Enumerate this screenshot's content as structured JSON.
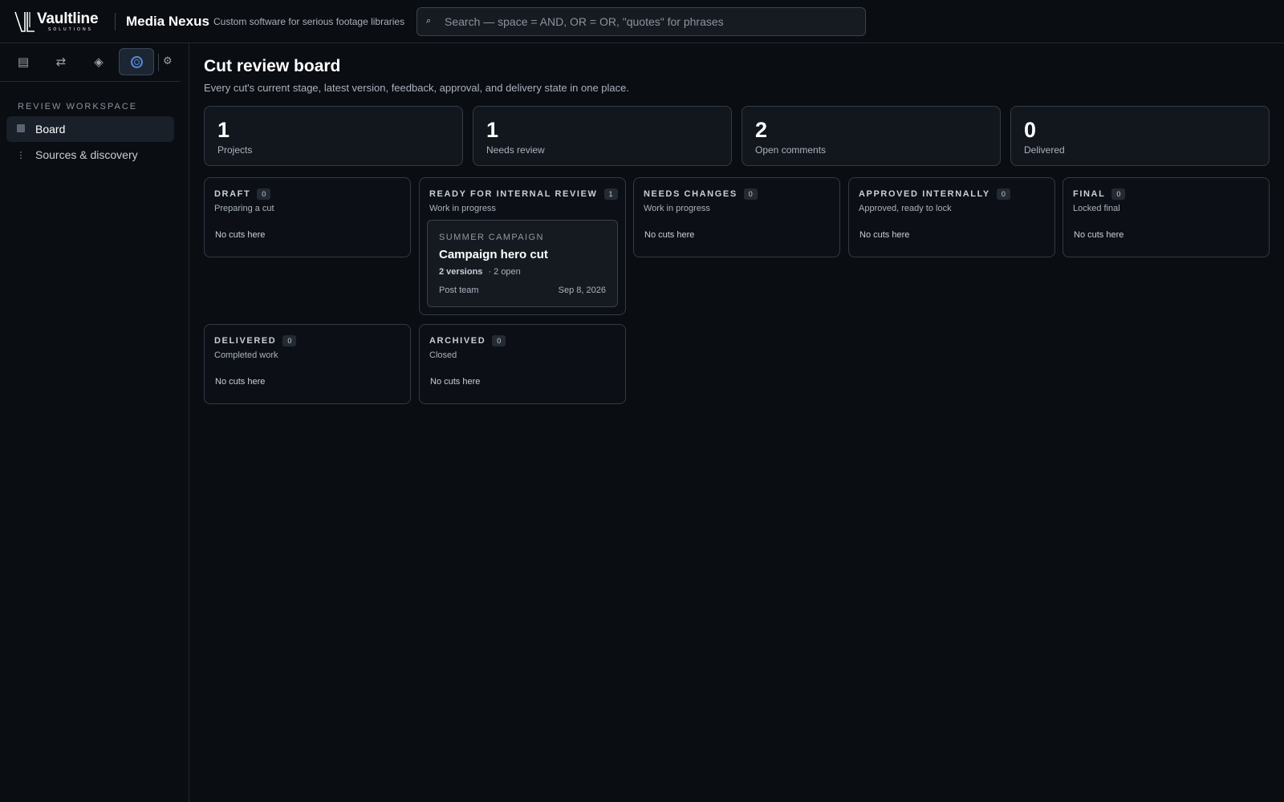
{
  "brand": {
    "logo_word": "Vaultline",
    "logo_sub": "SOLUTIONS",
    "app_name": "Media Nexus",
    "tagline": "Custom software for serious footage libraries"
  },
  "search": {
    "icon": "search-icon",
    "placeholder": "Search — space = AND, OR = OR, \"quotes\" for phrases",
    "value": ""
  },
  "rail": {
    "items": [
      {
        "icon": "library-icon",
        "glyph": "▤"
      },
      {
        "icon": "transfer-icon",
        "glyph": "⇄"
      },
      {
        "icon": "diamond-icon",
        "glyph": "◈"
      },
      {
        "icon": "review-ring-icon",
        "active": true
      },
      {
        "icon": "gear-icon",
        "glyph": "⚙"
      }
    ]
  },
  "sidebar": {
    "section_label": "REVIEW WORKSPACE",
    "items": [
      {
        "label": "Board",
        "icon": "board-square-icon",
        "active": true
      },
      {
        "label": "Sources & discovery",
        "icon": "dotted-line-icon",
        "glyph": "⋮",
        "active": false
      }
    ]
  },
  "page": {
    "title": "Cut review board",
    "subtitle": "Every cut's current stage, latest version, feedback, approval, and delivery state in one place."
  },
  "stats": [
    {
      "value": "1",
      "label": "Projects"
    },
    {
      "value": "1",
      "label": "Needs review"
    },
    {
      "value": "2",
      "label": "Open comments"
    },
    {
      "value": "0",
      "label": "Delivered"
    }
  ],
  "columns": [
    {
      "title": "DRAFT",
      "count": "0",
      "subtitle": "Preparing a cut",
      "empty": "No cuts here"
    },
    {
      "title": "READY FOR INTERNAL REVIEW",
      "count": "1",
      "subtitle": "Work in progress",
      "empty": ""
    },
    {
      "title": "NEEDS CHANGES",
      "count": "0",
      "subtitle": "Work in progress",
      "empty": "No cuts here"
    },
    {
      "title": "APPROVED INTERNALLY",
      "count": "0",
      "subtitle": "Approved, ready to lock",
      "empty": "No cuts here"
    },
    {
      "title": "FINAL",
      "count": "0",
      "subtitle": "Locked final",
      "empty": "No cuts here"
    },
    {
      "title": "DELIVERED",
      "count": "0",
      "subtitle": "Completed work",
      "empty": "No cuts here"
    },
    {
      "title": "ARCHIVED",
      "count": "0",
      "subtitle": "Closed",
      "empty": "No cuts here"
    }
  ],
  "card": {
    "project": "SUMMER CAMPAIGN",
    "title": "Campaign hero cut",
    "versions": "2 versions",
    "open": "· 2 open",
    "owner": "Post team",
    "date": "Sep 8, 2026"
  },
  "colors": {
    "background": "#0a0d12",
    "panel": "#12171e",
    "border": "#333b46",
    "accent": "#5a86d6"
  }
}
